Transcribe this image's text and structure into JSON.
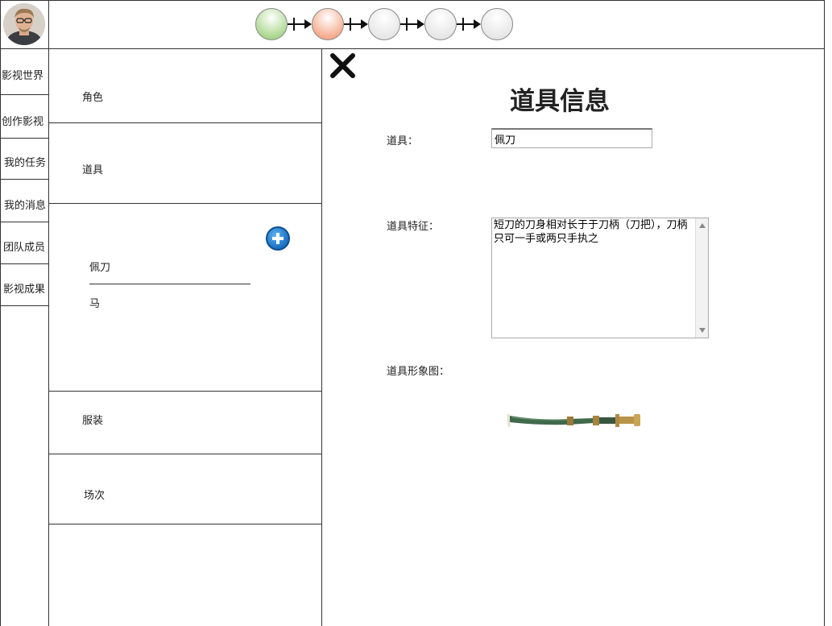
{
  "header": {
    "steps": [
      {
        "state": "done",
        "color": "#a9d68a"
      },
      {
        "state": "current",
        "color": "#f6a98a"
      },
      {
        "state": "pending",
        "color": "#e6e6e6"
      },
      {
        "state": "pending",
        "color": "#e6e6e6"
      },
      {
        "state": "pending",
        "color": "#e6e6e6"
      }
    ]
  },
  "nav": {
    "items": [
      {
        "label": "影视世界"
      },
      {
        "label": "创作影视"
      },
      {
        "label": "我的任务"
      },
      {
        "label": "我的消息"
      },
      {
        "label": "团队成员"
      },
      {
        "label": "影视成果"
      }
    ]
  },
  "categories": {
    "role": "角色",
    "props": "道具",
    "costume": "服装",
    "scene": "场次"
  },
  "prop_list": {
    "items": [
      "佩刀",
      "马"
    ],
    "add_icon": "plus-circle-icon"
  },
  "detail": {
    "close_icon": "close-x-icon",
    "title": "道具信息",
    "name_label": "道具：",
    "name_value": "佩刀",
    "desc_label": "道具特征：",
    "desc_value": "短刀的刀身相对长于于刀柄（刀把），刀柄只可一手或两只手执之",
    "image_label": "道具形象图："
  }
}
